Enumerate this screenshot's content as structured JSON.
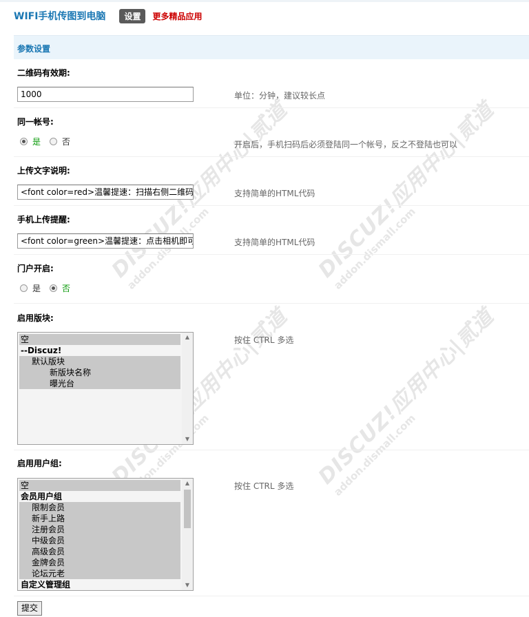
{
  "header": {
    "app_title": "WIFI手机传图到电脑",
    "settings_tab": "设置",
    "more_apps_link": "更多精品应用"
  },
  "section": {
    "title": "参数设置"
  },
  "watermark": {
    "main": "DISCUZ!应用中心|贰道",
    "sub": "addon.dismall.com"
  },
  "fields": {
    "qrcode_validity": {
      "label": "二维码有效期:",
      "value": "1000",
      "description": "单位：分钟，建议较长点"
    },
    "same_account": {
      "label": "同一帐号:",
      "option_yes": "是",
      "option_no": "否",
      "selected": "是",
      "description": "开启后，手机扫码后必须登陆同一个帐号，反之不登陆也可以"
    },
    "upload_text": {
      "label": "上传文字说明:",
      "value": "<font color=red>温馨提速：扫描右侧二维码",
      "description": "支持简单的HTML代码"
    },
    "mobile_reminder": {
      "label": "手机上传提醒:",
      "value": "<font color=green>温馨提速：点击相机即可",
      "description": "支持简单的HTML代码"
    },
    "portal_enabled": {
      "label": "门户开启:",
      "option_yes": "是",
      "option_no": "否",
      "selected": "否"
    },
    "enabled_blocks": {
      "label": "启用版块:",
      "description": "按住 CTRL 多选",
      "options": [
        {
          "text": "空",
          "selected": true,
          "group": false,
          "level": 0
        },
        {
          "text": "--Discuz!",
          "selected": false,
          "group": true,
          "level": 0
        },
        {
          "text": "默认版块",
          "selected": true,
          "group": false,
          "level": 1
        },
        {
          "text": "新版块名称",
          "selected": true,
          "group": false,
          "level": 2
        },
        {
          "text": "曝光台",
          "selected": true,
          "group": false,
          "level": 2
        }
      ]
    },
    "enabled_usergroups": {
      "label": "启用用户组:",
      "description": "按住 CTRL 多选",
      "options": [
        {
          "text": "空",
          "selected": true,
          "group": false,
          "level": 0
        },
        {
          "text": "会员用户组",
          "selected": false,
          "group": true,
          "level": 0
        },
        {
          "text": "限制会员",
          "selected": true,
          "group": false,
          "level": 1
        },
        {
          "text": "新手上路",
          "selected": true,
          "group": false,
          "level": 1
        },
        {
          "text": "注册会员",
          "selected": true,
          "group": false,
          "level": 1
        },
        {
          "text": "中级会员",
          "selected": true,
          "group": false,
          "level": 1
        },
        {
          "text": "高级会员",
          "selected": true,
          "group": false,
          "level": 1
        },
        {
          "text": "金牌会员",
          "selected": true,
          "group": false,
          "level": 1
        },
        {
          "text": "论坛元老",
          "selected": true,
          "group": false,
          "level": 1
        },
        {
          "text": "自定义管理组",
          "selected": false,
          "group": true,
          "level": 0
        }
      ]
    }
  },
  "submit_label": "提交"
}
